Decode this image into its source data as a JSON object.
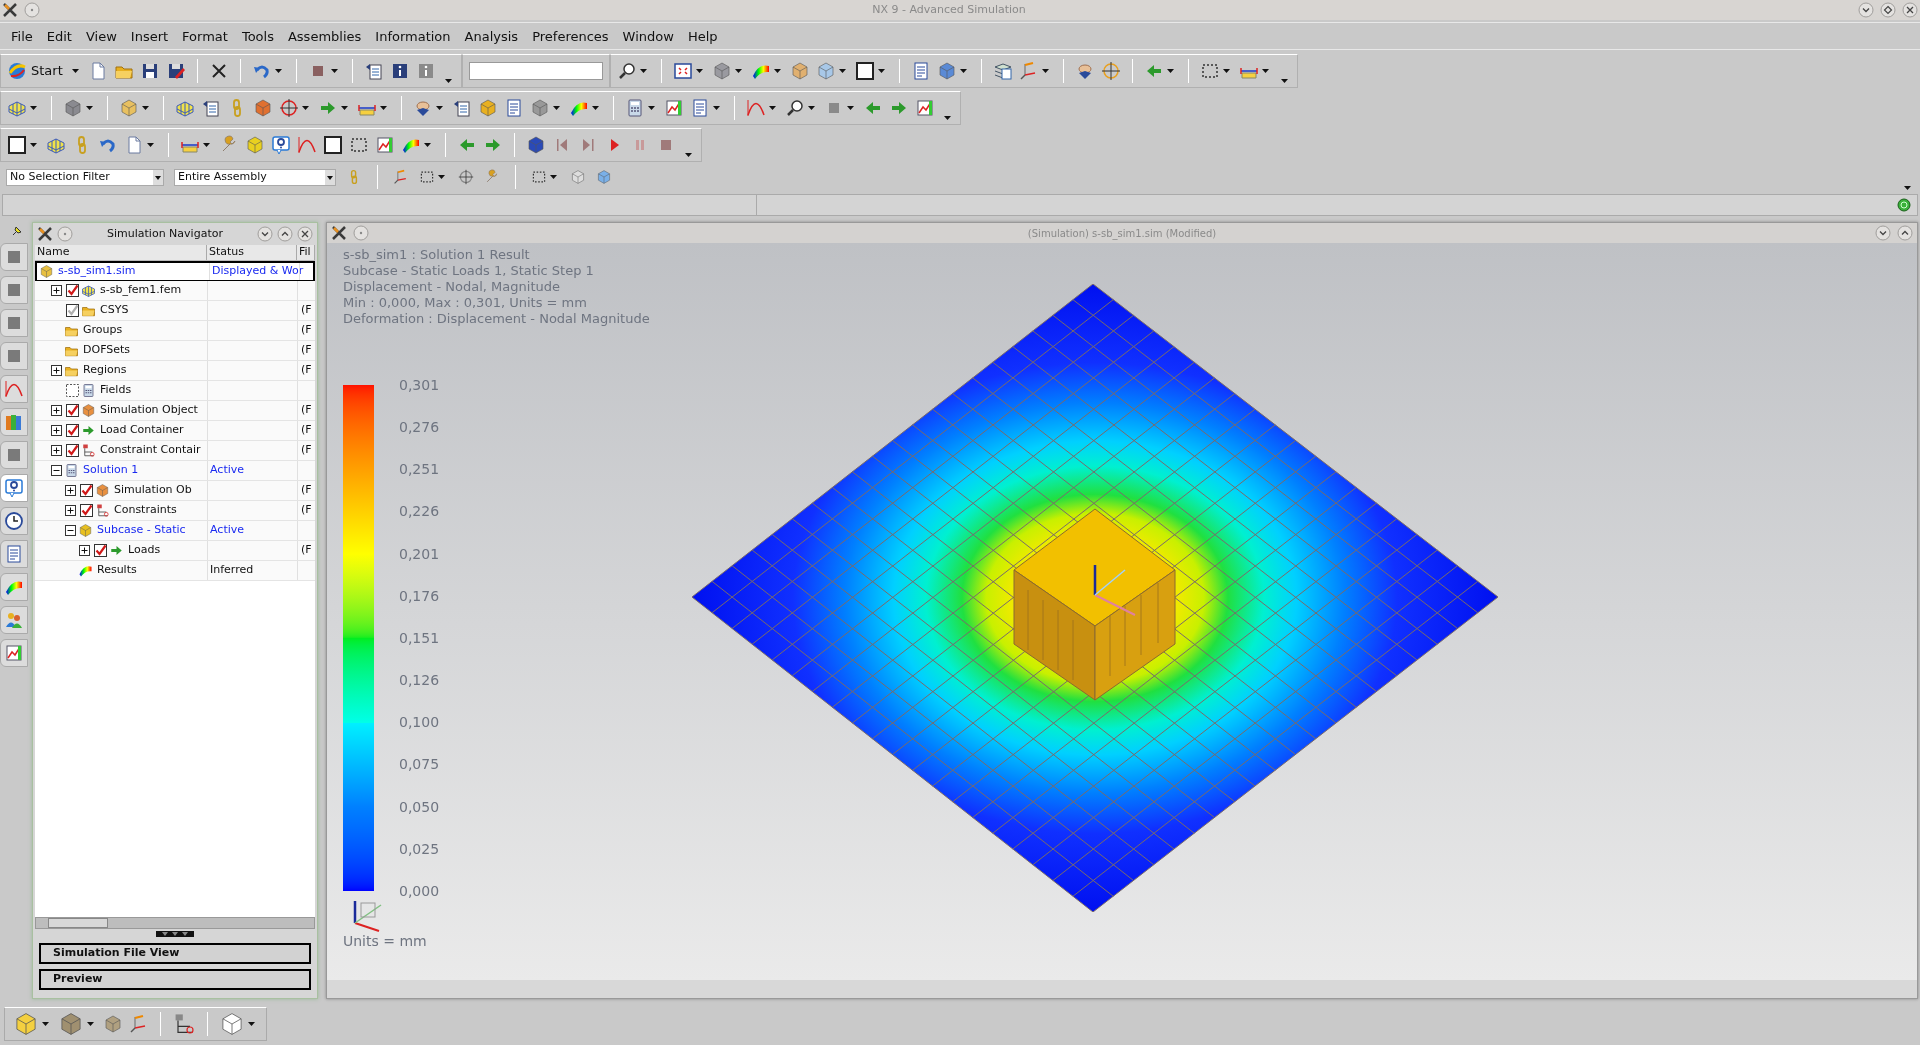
{
  "window": {
    "title": "NX 9 - Advanced Simulation"
  },
  "menu": [
    "File",
    "Edit",
    "View",
    "Insert",
    "Format",
    "Tools",
    "Assemblies",
    "Information",
    "Analysis",
    "Preferences",
    "Window",
    "Help"
  ],
  "toolbar": {
    "start_button": "Start"
  },
  "selection_bar": {
    "filter": "No Selection Filter",
    "scope": "Entire Assembly"
  },
  "resource_bar": [
    {
      "selected": false
    },
    {
      "selected": false
    },
    {
      "selected": false
    },
    {
      "selected": false
    },
    {
      "selected": false
    },
    {
      "selected": false
    },
    {
      "selected": false
    },
    {
      "selected": true
    },
    {
      "selected": false
    },
    {
      "selected": false
    },
    {
      "selected": false
    },
    {
      "selected": false
    },
    {
      "selected": false
    }
  ],
  "navigator": {
    "title": "Simulation Navigator",
    "columns": [
      "Name",
      "Status",
      "Fil"
    ],
    "tree": [
      {
        "name": "s-sb_sim1.sim",
        "status": "Displayed & Wor",
        "kind": "sim",
        "selected": true,
        "highlighted": true,
        "children": [
          {
            "name": "s-sb_fem1.fem",
            "kind": "mesh",
            "checked": true,
            "expanded": false
          },
          {
            "name": "CSYS",
            "kind": "folder",
            "checked": true,
            "disabled": true,
            "column_3": "(F"
          },
          {
            "name": "Groups",
            "kind": "folder",
            "column_3": "(F"
          },
          {
            "name": "DOFSets",
            "kind": "folder",
            "column_3": "(F"
          },
          {
            "name": "Regions",
            "kind": "folder",
            "expanded": false,
            "column_3": "(F"
          },
          {
            "name": "Fields",
            "kind": "fields",
            "checked": false
          },
          {
            "name": "Simulation Object",
            "kind": "object",
            "checked": true,
            "expanded": false,
            "column_3": "(F"
          },
          {
            "name": "Load Container",
            "kind": "load",
            "checked": true,
            "expanded": false,
            "column_3": "(F"
          },
          {
            "name": "Constraint Contair",
            "kind": "constraint",
            "checked": true,
            "expanded": false,
            "column_3": "(F"
          },
          {
            "name": "Solution 1",
            "status": "Active",
            "kind": "solution",
            "highlighted": true,
            "expanded": true,
            "children": [
              {
                "name": "Simulation Ob",
                "kind": "object",
                "checked": true,
                "expanded": false,
                "column_3": "(F"
              },
              {
                "name": "Constraints",
                "kind": "constraint",
                "checked": true,
                "expanded": false,
                "column_3": "(F"
              },
              {
                "name": "Subcase - Static",
                "status": "Active",
                "kind": "subcase",
                "highlighted": true,
                "expanded": true,
                "children": [
                  {
                    "name": "Loads",
                    "kind": "load",
                    "checked": true,
                    "expanded": false,
                    "column_3": "(F"
                  }
                ]
              },
              {
                "name": "Results",
                "status": "Inferred",
                "kind": "results"
              }
            ]
          }
        ]
      }
    ],
    "buttons": [
      "Simulation File View",
      "Preview"
    ]
  },
  "viewport": {
    "title": "(Simulation) s-sb_sim1.sim (Modified)",
    "info_lines": [
      "s-sb_sim1 : Solution 1 Result",
      "Subcase - Static Loads 1, Static Step 1",
      "Displacement - Nodal, Magnitude",
      "Min : 0,000, Max : 0,301, Units = mm",
      "Deformation : Displacement - Nodal Magnitude"
    ],
    "legend": {
      "labels": [
        "0,301",
        "0,276",
        "0,251",
        "0,226",
        "0,201",
        "0,176",
        "0,151",
        "0,126",
        "0,100",
        "0,075",
        "0,050",
        "0,025",
        "0,000"
      ],
      "units": "Units = mm"
    }
  }
}
